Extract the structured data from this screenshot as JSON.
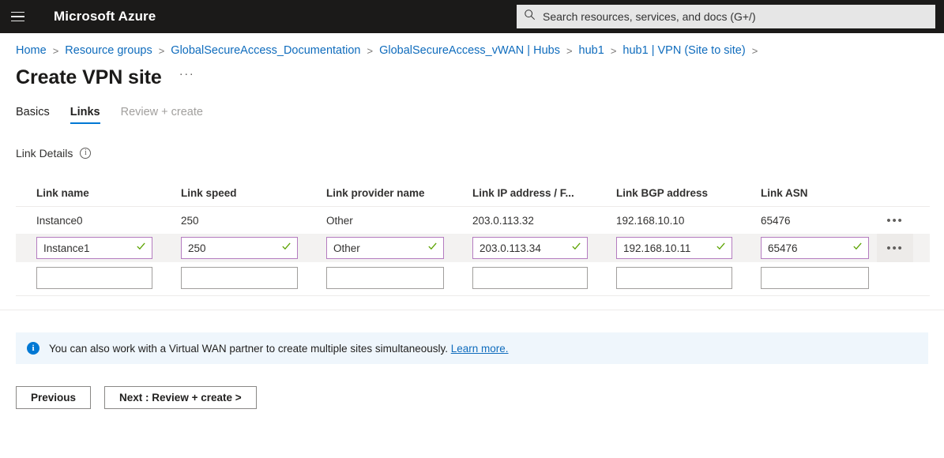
{
  "topbar": {
    "menu_icon": "hamburger-icon",
    "brand": "Microsoft Azure",
    "search_icon": "search-icon",
    "search_placeholder": "Search resources, services, and docs (G+/)",
    "search_value": ""
  },
  "breadcrumb": {
    "separator": ">",
    "items": [
      {
        "label": "Home"
      },
      {
        "label": "Resource groups"
      },
      {
        "label": "GlobalSecureAccess_Documentation"
      },
      {
        "label": "GlobalSecureAccess_vWAN | Hubs"
      },
      {
        "label": "hub1"
      },
      {
        "label": "hub1 | VPN (Site to site)"
      }
    ]
  },
  "page": {
    "title": "Create VPN site",
    "more_actions": "···"
  },
  "tabs": [
    {
      "label": "Basics",
      "state": "enabled"
    },
    {
      "label": "Links",
      "state": "active"
    },
    {
      "label": "Review + create",
      "state": "disabled"
    }
  ],
  "section": {
    "label": "Link Details",
    "info_icon": "info-icon",
    "info_glyph": "i"
  },
  "table": {
    "columns": [
      "Link name",
      "Link speed",
      "Link provider name",
      "Link IP address / F...",
      "Link BGP address",
      "Link ASN"
    ],
    "row_menu_glyph": "•••",
    "rows": [
      {
        "mode": "static",
        "cells": [
          "Instance0",
          "250",
          "Other",
          "203.0.113.32",
          "192.168.10.10",
          "65476"
        ]
      },
      {
        "mode": "editing",
        "cells": [
          "Instance1",
          "250",
          "Other",
          "203.0.113.34",
          "192.168.10.11",
          "65476"
        ],
        "validated": true
      },
      {
        "mode": "new",
        "cells": [
          "",
          "",
          "",
          "",
          "",
          ""
        ],
        "placeholders": [
          "",
          "",
          "",
          "",
          "",
          ""
        ]
      }
    ]
  },
  "banner": {
    "icon": "info-icon",
    "icon_glyph": "i",
    "text": "You can also work with a Virtual WAN partner to create multiple sites simultaneously.",
    "link_label": "Learn more."
  },
  "footer": {
    "previous_label": "Previous",
    "next_label": "Next : Review + create >"
  },
  "colors": {
    "azure_blue": "#0078d4",
    "link_blue": "#0f6cbd",
    "validated_border": "#b47cc0",
    "check_green": "#5ba300",
    "banner_bg": "#eff6fc",
    "edit_row_bg": "#f3f2f1",
    "topbar_bg": "#1b1a19"
  }
}
